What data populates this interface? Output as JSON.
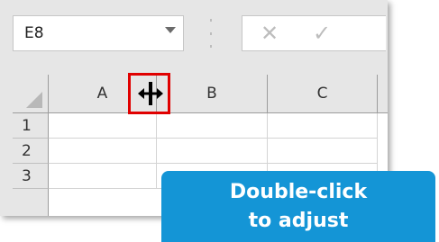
{
  "formula_bar": {
    "name_box_value": "E8"
  },
  "columns": [
    {
      "label": "A"
    },
    {
      "label": "B"
    },
    {
      "label": "C"
    }
  ],
  "rows": [
    {
      "label": "1"
    },
    {
      "label": "2"
    },
    {
      "label": "3"
    }
  ],
  "callout": {
    "line1": "Double-click",
    "line2": "to adjust"
  },
  "colors": {
    "highlight": "#e00000",
    "callout_bg": "#1495d6"
  },
  "icons": {
    "cancel": "x-icon",
    "enter": "check-icon",
    "resize_cursor": "column-resize-cursor-icon"
  }
}
